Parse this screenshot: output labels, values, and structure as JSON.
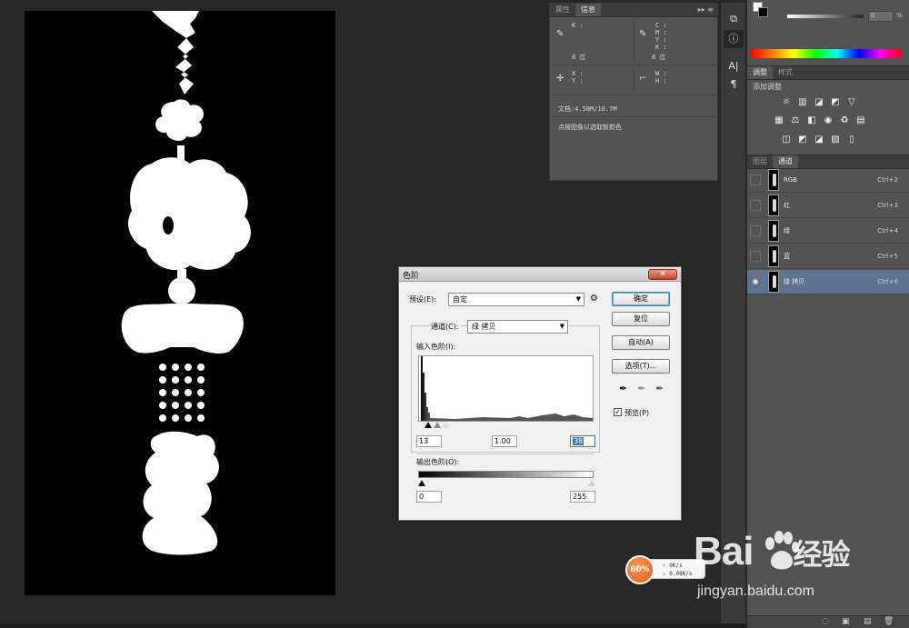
{
  "info_panel": {
    "tabs": [
      "属性",
      "信息"
    ],
    "active_tab": 1,
    "menu_glyph": "▸▸ ≡",
    "left_k": "K :",
    "left_bits": "8 位",
    "right_cmyk": [
      "C :",
      "M :",
      "Y :",
      "K :"
    ],
    "right_bits": "8 位",
    "xy": [
      "X :",
      "Y :"
    ],
    "wh": [
      "W :",
      "H :"
    ],
    "doc_size": "文档:4.58M/10.7M",
    "hint": "点按图像以选取新颜色"
  },
  "adjustments": {
    "tabs": [
      "调整",
      "样式"
    ],
    "title": "添加调整"
  },
  "channels": {
    "tabs": [
      "图层",
      "通道"
    ],
    "rows": [
      {
        "name": "RGB",
        "shortcut": "Ctrl+2",
        "visible": false,
        "selected": false
      },
      {
        "name": "红",
        "shortcut": "Ctrl+3",
        "visible": false,
        "selected": false
      },
      {
        "name": "绿",
        "shortcut": "Ctrl+4",
        "visible": false,
        "selected": false
      },
      {
        "name": "蓝",
        "shortcut": "Ctrl+5",
        "visible": false,
        "selected": false
      },
      {
        "name": "绿 拷贝",
        "shortcut": "Ctrl+6",
        "visible": true,
        "selected": true
      }
    ]
  },
  "color_panel": {
    "value": "0",
    "unit": "%"
  },
  "levels": {
    "title": "色阶",
    "close": "✕",
    "preset_label": "预设(E):",
    "preset_value": "自定",
    "channel_label": "通道(C):",
    "channel_value": "绿 拷贝",
    "input_label": "输入色阶(I):",
    "output_label": "输出色阶(O):",
    "input_black": "13",
    "input_gamma": "1.00",
    "input_white": "38",
    "output_black": "0",
    "output_white": "255",
    "buttons": {
      "ok": "确定",
      "reset": "复位",
      "auto": "自动(A)",
      "options": "选项(T)..."
    },
    "preview_label": "预览(P)",
    "preview_checked": true
  },
  "speed_widget": {
    "percent": "80%",
    "up": "0K/s",
    "down": "0.08K/s"
  },
  "watermark": {
    "logo": "Bai",
    "logo_cn": "经验",
    "url": "jingyan.baidu.com"
  }
}
